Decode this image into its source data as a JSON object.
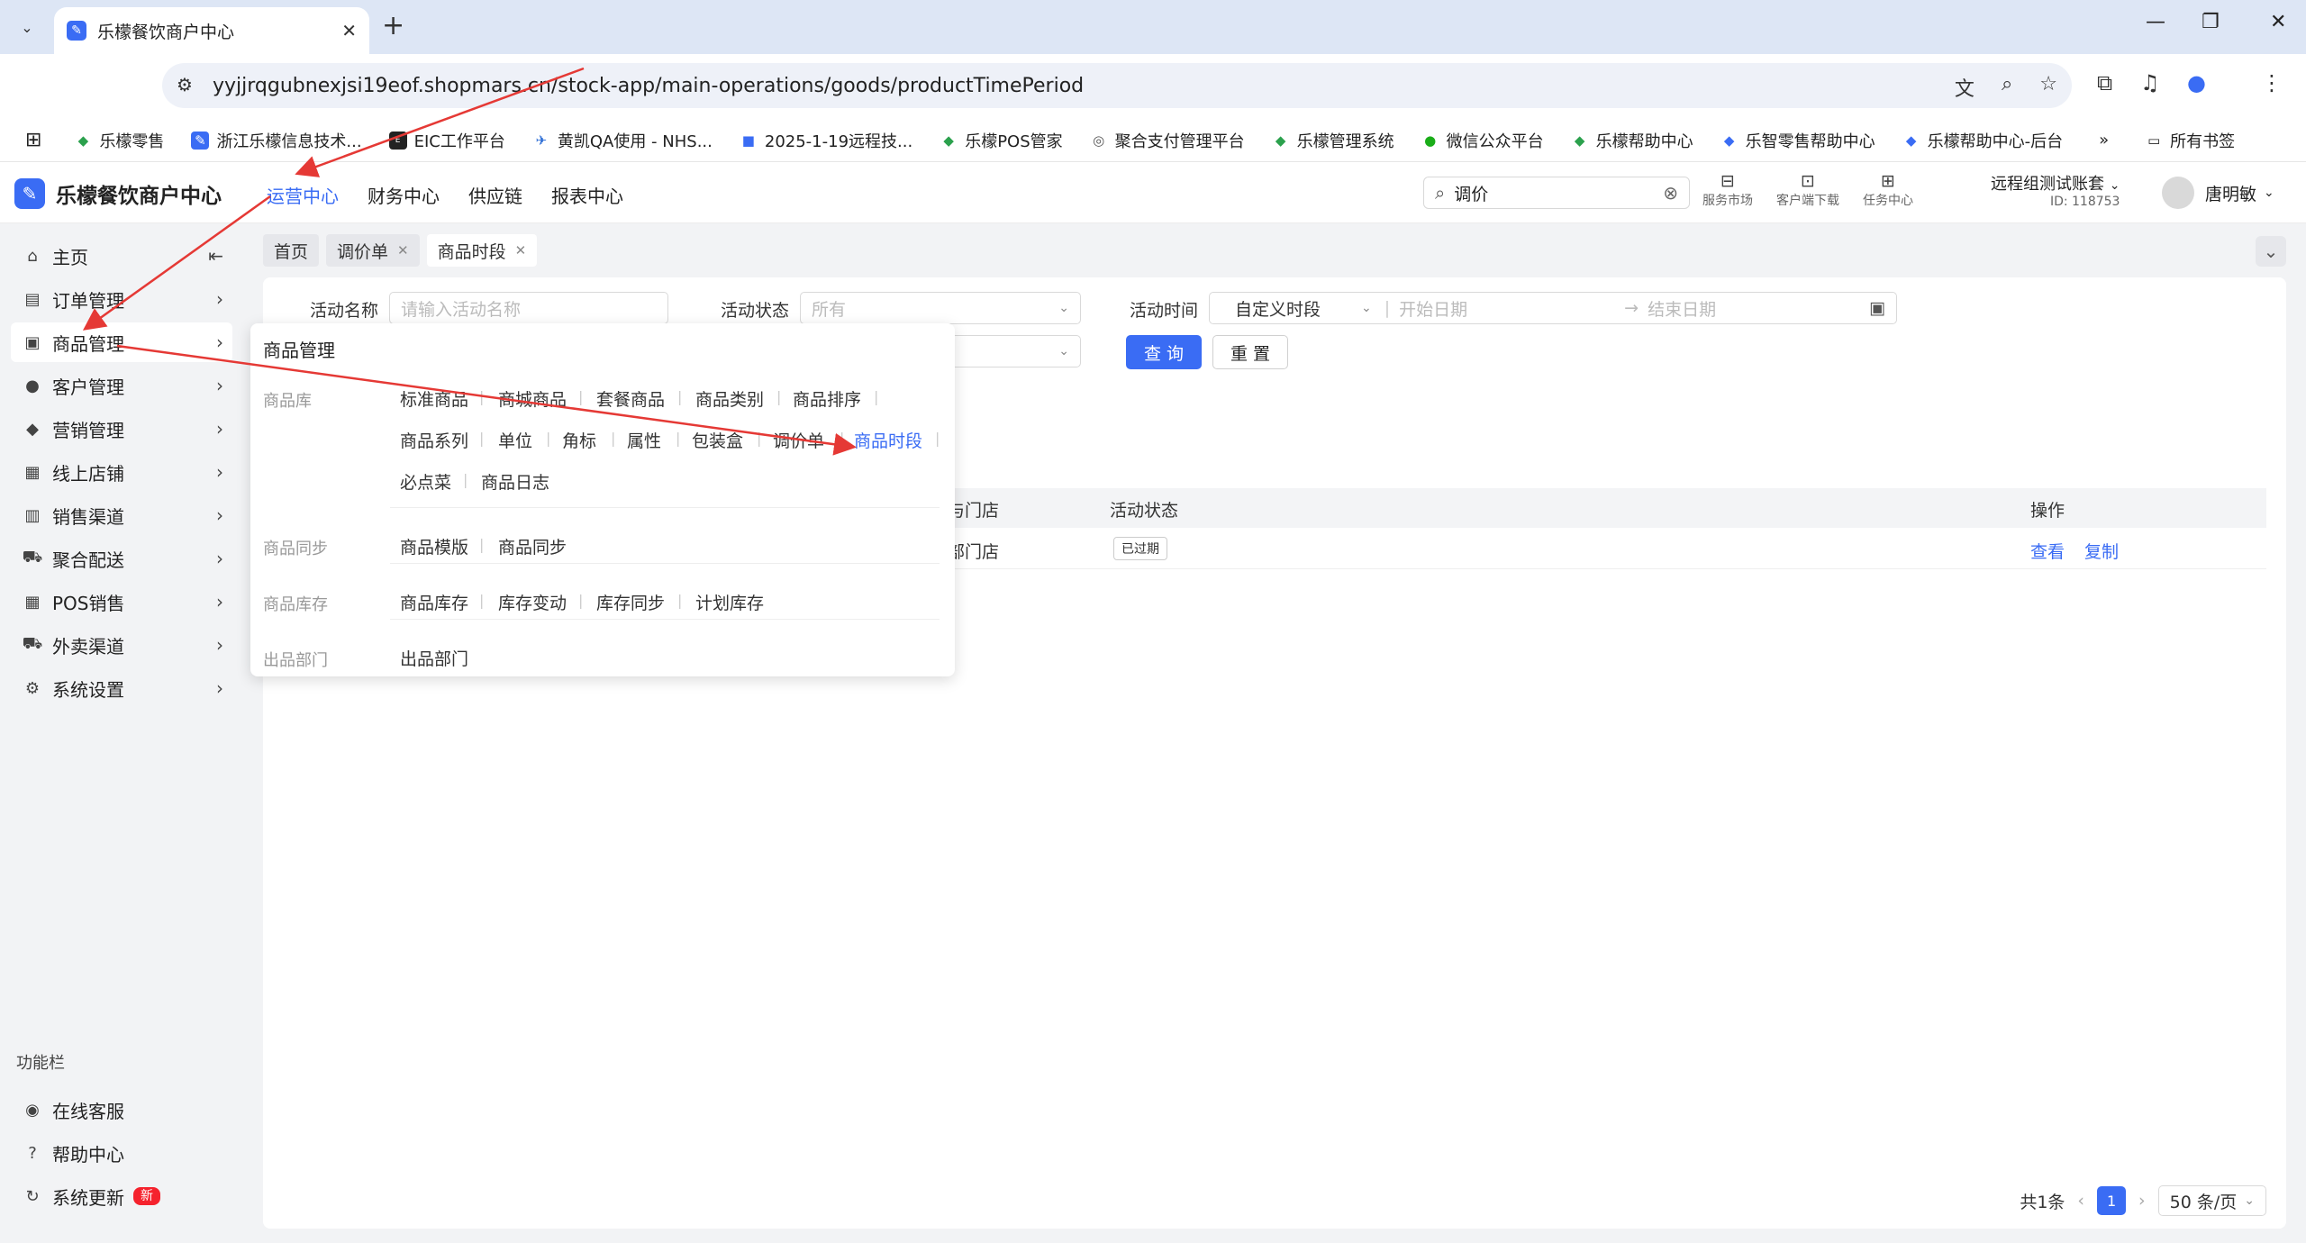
{
  "browser": {
    "tab_title": "乐檬餐饮商户中心",
    "url": "yyjjrqgubnexjsi19eof.shopmars.cn/stock-app/main-operations/goods/productTimePeriod",
    "bookmarks": [
      "乐檬零售",
      "浙江乐檬信息技术...",
      "EIC工作平台",
      "黄凯QA使用 - NHS...",
      "2025-1-19远程技...",
      "乐檬POS管家",
      "聚合支付管理平台",
      "乐檬管理系统",
      "微信公众平台",
      "乐檬帮助中心",
      "乐智零售帮助中心",
      "乐檬帮助中心-后台"
    ],
    "all_bookmarks": "所有书签"
  },
  "app": {
    "title": "乐檬餐饮商户中心",
    "nav": [
      "运营中心",
      "财务中心",
      "供应链",
      "报表中心"
    ],
    "search_value": "调价",
    "header_icons": [
      "服务市场",
      "客户端下载",
      "任务中心"
    ],
    "account_name": "远程组测试账套",
    "account_id": "ID: 118753",
    "user_name": "唐明敏"
  },
  "sidebar": {
    "items": [
      "主页",
      "订单管理",
      "商品管理",
      "客户管理",
      "营销管理",
      "线上店铺",
      "销售渠道",
      "聚合配送",
      "POS销售",
      "外卖渠道",
      "系统设置"
    ],
    "func_label": "功能栏",
    "func_items": [
      "在线客服",
      "帮助中心",
      "系统更新"
    ],
    "new_badge": "新"
  },
  "tabs": [
    "首页",
    "调价单",
    "商品时段"
  ],
  "filters": {
    "name_label": "活动名称",
    "name_placeholder": "请输入活动名称",
    "status_label": "活动状态",
    "status_value": "所有",
    "time_label": "活动时间",
    "time_mode": "自定义时段",
    "start_placeholder": "开始日期",
    "end_placeholder": "结束日期",
    "query": "查 询",
    "reset": "重 置"
  },
  "table": {
    "headers": [
      "适用门店",
      "活动状态",
      "操作"
    ],
    "header_store_partial": "与门店",
    "row": {
      "store": "部门店",
      "status": "已过期",
      "view": "查看",
      "copy": "复制"
    }
  },
  "pager": {
    "total": "共1条",
    "page": "1",
    "size": "50 条/页"
  },
  "popup": {
    "title": "商品管理",
    "sections": [
      {
        "label": "商品库",
        "items": [
          "标准商品",
          "商城商品",
          "套餐商品",
          "商品类别",
          "商品排序",
          "商品系列",
          "单位",
          "角标",
          "属性",
          "包装盒",
          "调价单",
          "商品时段",
          "必点菜",
          "商品日志"
        ]
      },
      {
        "label": "商品同步",
        "items": [
          "商品模版",
          "商品同步"
        ]
      },
      {
        "label": "商品库存",
        "items": [
          "商品库存",
          "库存变动",
          "库存同步",
          "计划库存"
        ]
      },
      {
        "label": "出品部门",
        "items": [
          "出品部门"
        ]
      }
    ]
  }
}
